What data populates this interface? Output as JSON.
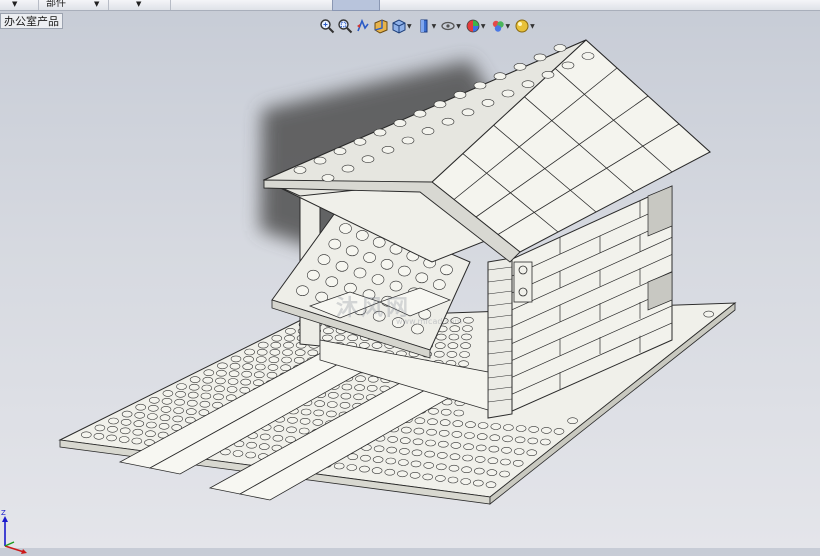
{
  "toolbar": {
    "menu1_label": "",
    "menu2_label": "部件",
    "menu3_label": ""
  },
  "tree": {
    "root_label": "办公室产品"
  },
  "view_toolbar": {
    "buttons": [
      "zoom-to-fit-icon",
      "zoom-to-area-icon",
      "previous-view-icon",
      "section-view-icon",
      "view-orientation-icon",
      "display-style-icon",
      "hide-show-items-icon",
      "edit-appearance-icon",
      "apply-scene-icon",
      "view-settings-icon"
    ]
  },
  "watermark": {
    "text": "沐风网",
    "url": "www.mfcad.com"
  },
  "triad": {
    "x_label": "X",
    "y_label": "Y",
    "z_label": "Z"
  },
  "colors": {
    "part_fill": "#f0f0ea",
    "part_edge": "#2a2a2a",
    "shadow": "#5a5a5a",
    "background_top": "#c7ccd6",
    "background_bottom": "#e4e5ea"
  }
}
